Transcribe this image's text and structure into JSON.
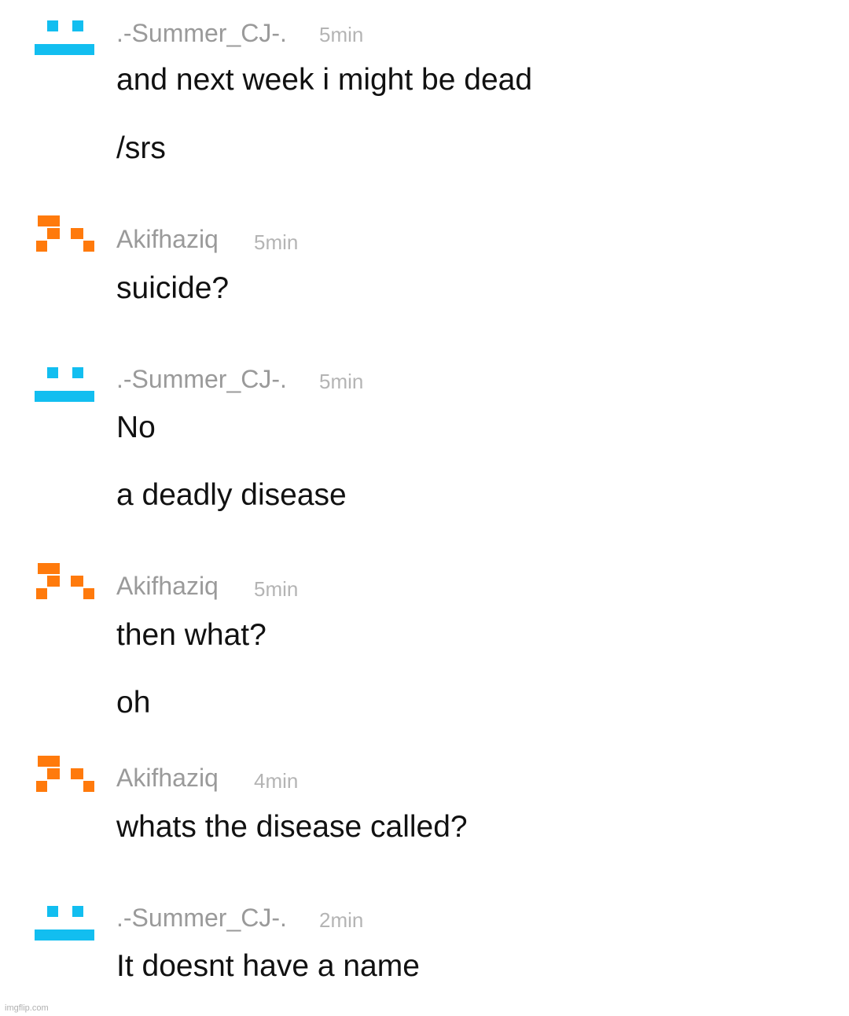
{
  "messages": [
    {
      "user": ".-Summer_CJ-.",
      "avatar": "cyan-pixel-face-icon",
      "time": "5min",
      "lines": [
        "and next week i might be dead",
        "/srs"
      ]
    },
    {
      "user": "Akifhaziq",
      "avatar": "orange-pixel-face-icon",
      "time": "5min",
      "lines": [
        "suicide?"
      ]
    },
    {
      "user": ".-Summer_CJ-.",
      "avatar": "cyan-pixel-face-icon",
      "time": "5min",
      "lines": [
        "No",
        "a deadly disease"
      ]
    },
    {
      "user": "Akifhaziq",
      "avatar": "orange-pixel-face-icon",
      "time": "5min",
      "lines": [
        "then what?",
        "oh"
      ]
    },
    {
      "user": "Akifhaziq",
      "avatar": "orange-pixel-face-icon",
      "time": "4min",
      "lines": [
        "whats the disease called?"
      ]
    },
    {
      "user": ".-Summer_CJ-.",
      "avatar": "cyan-pixel-face-icon",
      "time": "2min",
      "lines": [
        "It doesnt have a name"
      ]
    }
  ],
  "watermark": "imgflip.com",
  "colors": {
    "cyan_avatar": "#12bef0",
    "orange_avatar": "#ff7a0c",
    "username": "#9a9a9a",
    "timestamp": "#b4b4b4",
    "message_text": "#111111"
  }
}
